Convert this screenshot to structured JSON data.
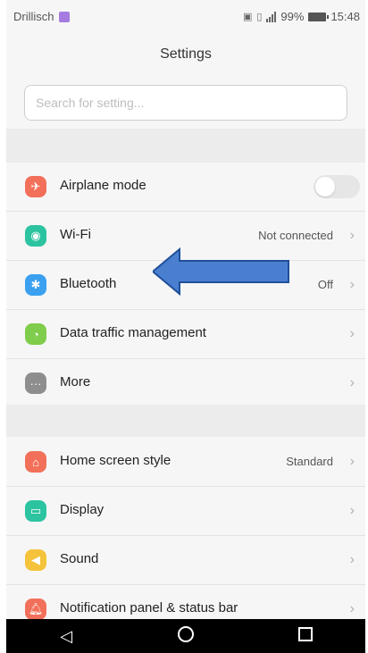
{
  "status": {
    "carrier": "Drillisch",
    "battery": "99%",
    "time": "15:48"
  },
  "title": "Settings",
  "search": {
    "placeholder": "Search for setting..."
  },
  "groups": [
    {
      "items": [
        {
          "label": "Airplane mode",
          "icon": "airplane-icon",
          "color": "#f2705a",
          "toggle": false
        },
        {
          "label": "Wi-Fi",
          "icon": "wifi-icon",
          "color": "#2cc3a0",
          "value": "Not connected"
        },
        {
          "label": "Bluetooth",
          "icon": "bluetooth-icon",
          "color": "#3aa0ef",
          "value": "Off"
        },
        {
          "label": "Data traffic management",
          "icon": "data-traffic-icon",
          "color": "#7fcd4a"
        },
        {
          "label": "More",
          "icon": "more-icon",
          "color": "#8e8e8e"
        }
      ]
    },
    {
      "items": [
        {
          "label": "Home screen style",
          "icon": "home-icon",
          "color": "#f2705a",
          "value": "Standard"
        },
        {
          "label": "Display",
          "icon": "display-icon",
          "color": "#2cc3a0"
        },
        {
          "label": "Sound",
          "icon": "sound-icon",
          "color": "#f5c33b"
        },
        {
          "label": "Notification panel & status bar",
          "icon": "notification-icon",
          "color": "#f2705a"
        }
      ]
    }
  ],
  "colors": {
    "arrow": "#4a7fd0"
  }
}
